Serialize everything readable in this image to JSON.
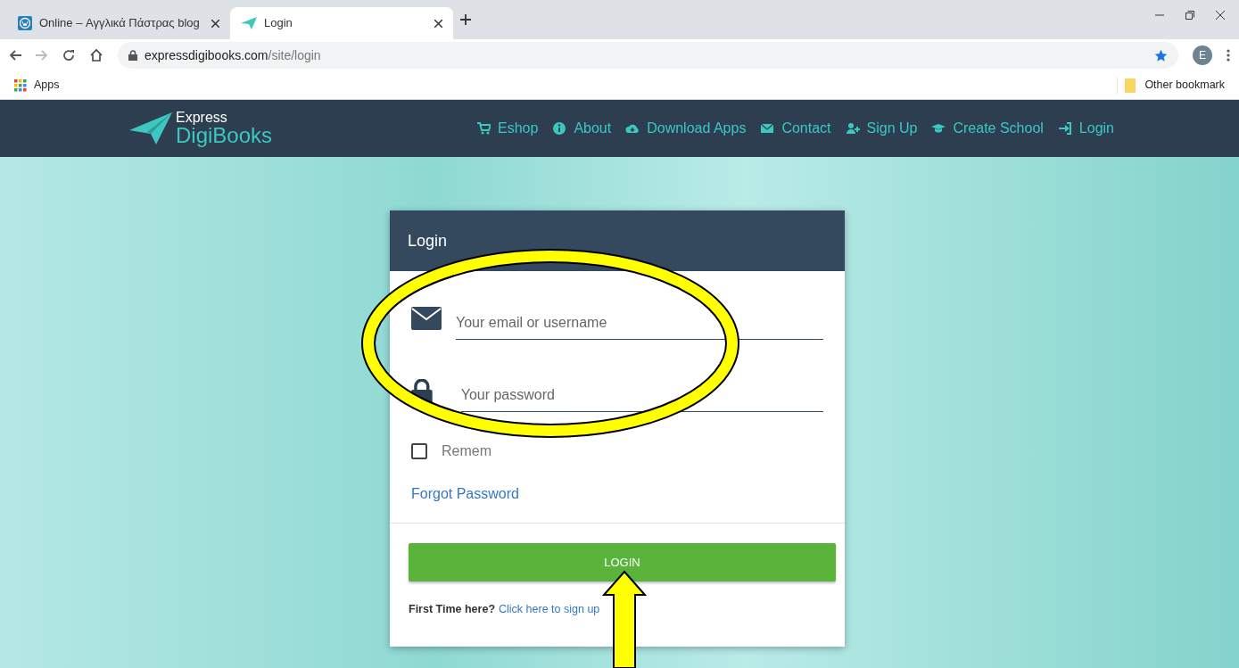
{
  "browser": {
    "tabs": [
      {
        "title": "Online – Αγγλικά Πάστρας blog",
        "selected": false
      },
      {
        "title": "Login",
        "selected": true
      }
    ],
    "address": {
      "host": "expressdigibooks.com",
      "path": "/site/login"
    },
    "profile": "E",
    "bookmarks": {
      "apps": "Apps",
      "other": "Other bookmark"
    }
  },
  "site": {
    "logo": {
      "line_1": "Express",
      "line_2": "DigiBooks"
    },
    "nav": [
      {
        "label": "Eshop"
      },
      {
        "label": "About"
      },
      {
        "label": "Download Apps"
      },
      {
        "label": "Contact"
      },
      {
        "label": "Sign Up"
      },
      {
        "label": "Create School"
      },
      {
        "label": "Login"
      }
    ]
  },
  "login_card": {
    "title": "Login",
    "email": {
      "placeholder": "Your email or username"
    },
    "password": {
      "placeholder": "Your password"
    },
    "remember": {
      "label": "Remem",
      "checked": false
    },
    "forgot": "Forgot Password",
    "button": "LOGIN",
    "signup": {
      "prompt": "First Time here?",
      "link": "Click here to sign up"
    }
  }
}
